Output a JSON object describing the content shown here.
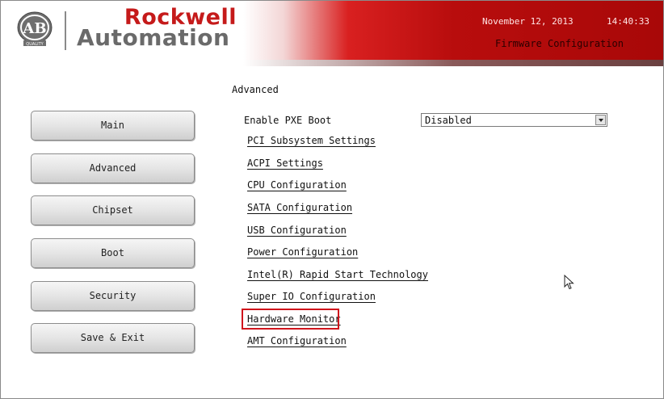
{
  "header": {
    "brand_top": "Rockwell",
    "brand_bottom": "Automation",
    "badge_text": "AB",
    "badge_subtext": "QUALITY",
    "date": "November 12, 2013",
    "time": "14:40:33",
    "title": "Firmware Configuration",
    "colors": {
      "brand_red": "#c51a1a",
      "header_red": "#b80d0d",
      "brand_gray": "#6a6a6a"
    }
  },
  "nav": {
    "items": [
      {
        "label": "Main"
      },
      {
        "label": "Advanced"
      },
      {
        "label": "Chipset"
      },
      {
        "label": "Boot"
      },
      {
        "label": "Security"
      },
      {
        "label": "Save & Exit"
      }
    ]
  },
  "main": {
    "section_title": "Advanced",
    "pxe": {
      "label": "Enable PXE Boot",
      "value": "Disabled"
    },
    "links": [
      "PCI Subsystem Settings",
      "ACPI Settings",
      "CPU Configuration",
      "SATA Configuration",
      "USB Configuration",
      "Power Configuration",
      "Intel(R) Rapid Start Technology",
      "Super IO Configuration",
      "Hardware Monitor",
      "AMT Configuration"
    ],
    "highlighted_link": "Hardware Monitor",
    "highlight_color": "#d0141c"
  },
  "icons": {
    "cursor": "mouse-pointer-icon",
    "logo": "ab-logo-icon",
    "dropdown": "chevron-down-icon"
  }
}
